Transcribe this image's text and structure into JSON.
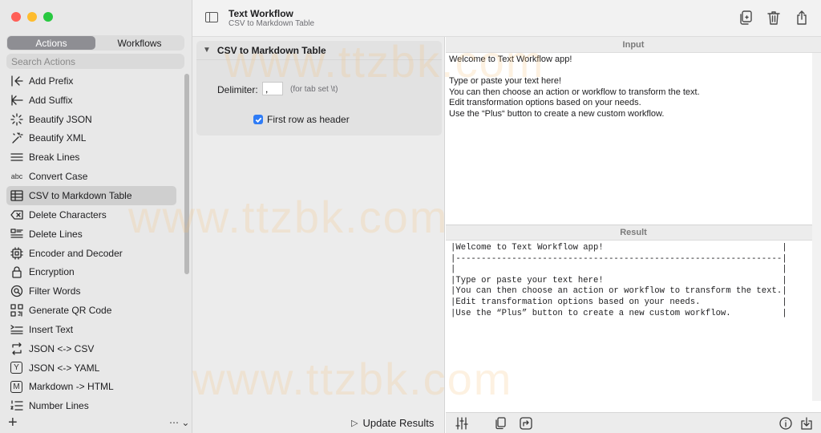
{
  "window": {
    "title": "Text Workflow",
    "subtitle": "CSV to Markdown Table",
    "traffic_colors": [
      "#ff5f57",
      "#febc2e",
      "#28c840"
    ]
  },
  "sidebar": {
    "tabs": [
      {
        "label": "Actions",
        "active": true
      },
      {
        "label": "Workflows",
        "active": false
      }
    ],
    "search_placeholder": "Search Actions",
    "items": [
      {
        "label": "Add Prefix",
        "icon": "add-prefix-icon"
      },
      {
        "label": "Add Suffix",
        "icon": "add-suffix-icon"
      },
      {
        "label": "Beautify JSON",
        "icon": "sparkle-icon"
      },
      {
        "label": "Beautify XML",
        "icon": "magic-wand-icon"
      },
      {
        "label": "Break Lines",
        "icon": "lines-icon"
      },
      {
        "label": "Convert Case",
        "icon": "abc-icon"
      },
      {
        "label": "CSV to Markdown Table",
        "icon": "table-icon",
        "selected": true
      },
      {
        "label": "Delete Characters",
        "icon": "delete-left-icon"
      },
      {
        "label": "Delete Lines",
        "icon": "delete-lines-icon"
      },
      {
        "label": "Encoder and Decoder",
        "icon": "chip-icon"
      },
      {
        "label": "Encryption",
        "icon": "lock-icon"
      },
      {
        "label": "Filter Words",
        "icon": "magnifier-icon"
      },
      {
        "label": "Generate QR Code",
        "icon": "qrcode-icon"
      },
      {
        "label": "Insert Text",
        "icon": "insert-text-icon"
      },
      {
        "label": "JSON <-> CSV",
        "icon": "swap-icon"
      },
      {
        "label": "JSON <-> YAML",
        "icon": "y-box-icon"
      },
      {
        "label": "Markdown -> HTML",
        "icon": "m-box-icon"
      },
      {
        "label": "Number Lines",
        "icon": "numbered-list-icon"
      }
    ],
    "abc_text": "abc",
    "y_text": "Y",
    "m_text": "M",
    "more_text": "⋯ ⌄"
  },
  "action_panel": {
    "title": "CSV to Markdown Table",
    "delimiter_label": "Delimiter:",
    "delimiter_value": ",",
    "delimiter_hint": "(for tab set \\t)",
    "first_row_header_label": "First row as header",
    "first_row_header_checked": true,
    "update_label": "Update Results"
  },
  "input": {
    "header": "Input",
    "text": "Welcome to Text Workflow app!\n\nType or paste your text here!\nYou can then choose an action or workflow to transform the text.\nEdit transformation options based on your needs.\nUse the “Plus“ button to create a new custom workflow."
  },
  "result": {
    "header": "Result",
    "text": "|Welcome to Text Workflow app!                                   |\n|----------------------------------------------------------------|\n|                                                                |\n|Type or paste your text here!                                   |\n|You can then choose an action or workflow to transform the text.|\n|Edit transformation options based on your needs.                |\n|Use the “Plus” button to create a new custom workflow.          |"
  },
  "watermark": "www.ttzbk.com"
}
